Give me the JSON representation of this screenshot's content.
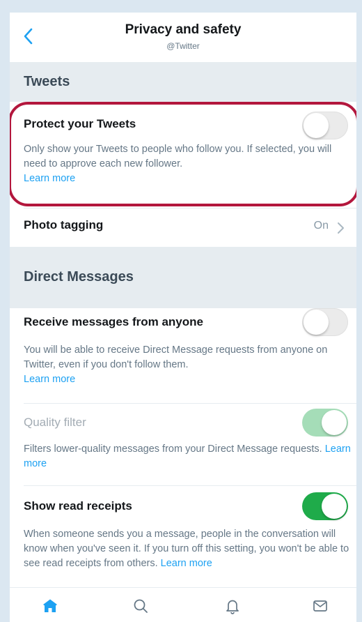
{
  "header": {
    "title": "Privacy and safety",
    "subtitle": "@Twitter"
  },
  "sections": {
    "tweets": {
      "title": "Tweets",
      "protect": {
        "title": "Protect your Tweets",
        "desc": "Only show your Tweets to people who follow you. If selected, you will need to approve each new follower.",
        "link": "Learn more",
        "enabled": false
      },
      "photo_tagging": {
        "title": "Photo tagging",
        "value": "On"
      }
    },
    "dm": {
      "title": "Direct Messages",
      "receive": {
        "title": "Receive messages from anyone",
        "desc": "You will be able to receive Direct Message requests from anyone on Twitter, even if you don't follow them.",
        "link": "Learn more",
        "enabled": false
      },
      "quality": {
        "title": "Quality filter",
        "desc": "Filters lower-quality messages from your Direct Message requests.",
        "link": "Learn more",
        "enabled": true,
        "disabled": true
      },
      "read_receipts": {
        "title": "Show read receipts",
        "desc": "When someone sends you a message, people in the conversation will know when you've seen it. If you turn off this setting, you won't be able to see read receipts from others.",
        "link": "Learn more",
        "enabled": true
      }
    }
  },
  "colors": {
    "accent": "#1da1f2",
    "toggle_on": "#1fab4a",
    "highlight": "#b3173d"
  },
  "tabbar": {
    "icons": [
      "home-icon",
      "search-icon",
      "notifications-icon",
      "messages-icon"
    ],
    "active": "home-icon"
  }
}
